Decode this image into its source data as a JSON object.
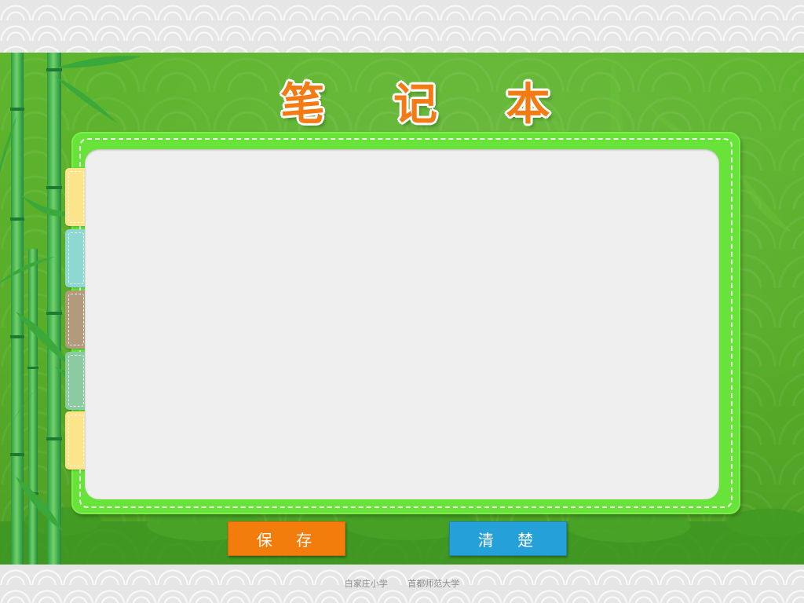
{
  "title": "笔 记 本",
  "note": {
    "placeholder": "",
    "value": ""
  },
  "buttons": {
    "save_label": "保 存",
    "clear_label": "清 楚"
  },
  "footer": {
    "school": "白家庄小学",
    "university": "首都师范大学"
  },
  "tabs": [
    {
      "name": "tab-yellow-top",
      "color": "#fbe48a"
    },
    {
      "name": "tab-teal",
      "color": "#8ed8d2"
    },
    {
      "name": "tab-brown",
      "color": "#b29a7d"
    },
    {
      "name": "tab-green",
      "color": "#8ccba1"
    },
    {
      "name": "tab-yellow-bottom",
      "color": "#fbe48a"
    }
  ],
  "colors": {
    "stage_green": "#5fb52e",
    "board_green": "#68e33a",
    "title_orange": "#f47b14",
    "save_orange": "#f27d0c",
    "clear_blue": "#26a0d8"
  }
}
